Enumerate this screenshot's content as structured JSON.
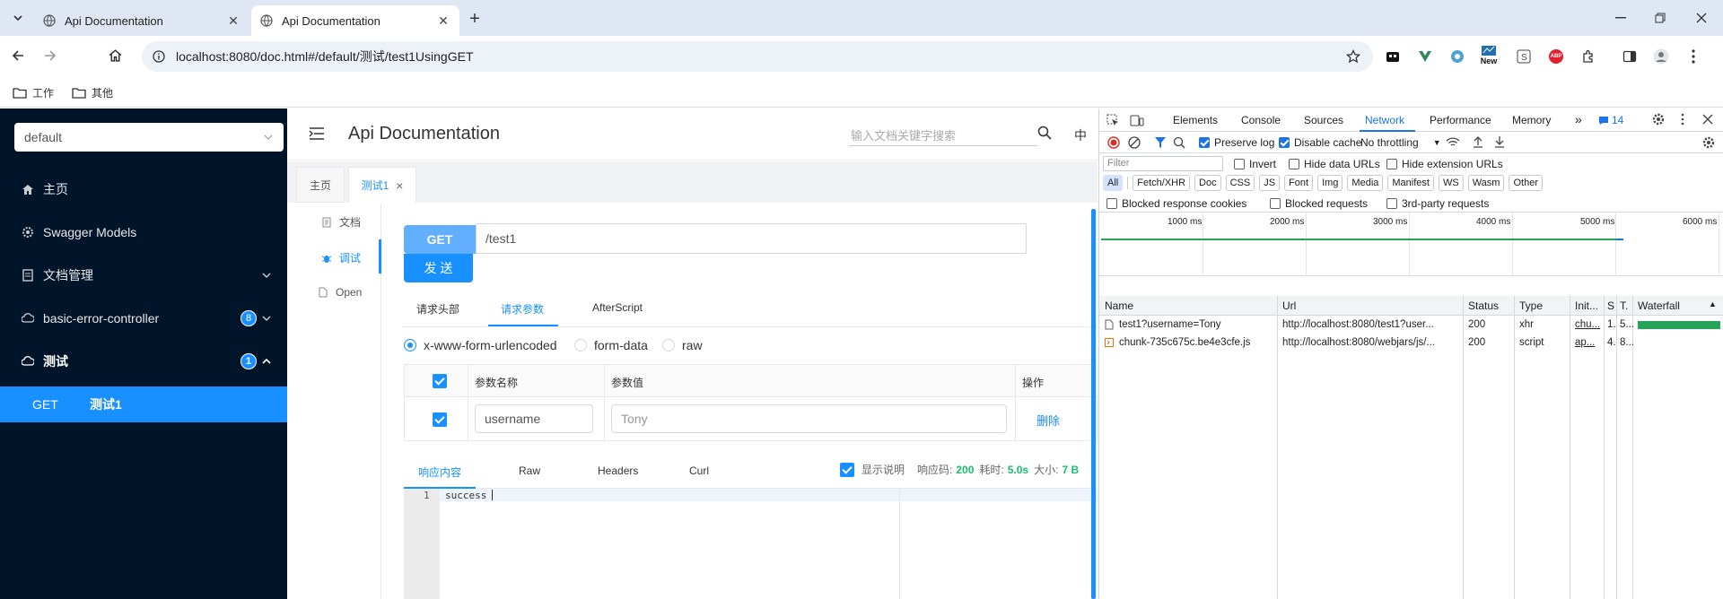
{
  "browser": {
    "tabs": [
      {
        "title": "Api Documentation",
        "active": false
      },
      {
        "title": "Api Documentation",
        "active": true
      }
    ],
    "url": "localhost:8080/doc.html#/default/测试/test1UsingGET",
    "bookmarks": [
      "工作",
      "其他"
    ],
    "extension_new_label": "New",
    "extension_abp_label": "ABP"
  },
  "sidebar": {
    "group_select": "default",
    "items": [
      {
        "label": "主页",
        "icon": "home-icon"
      },
      {
        "label": "Swagger Models",
        "icon": "gear-icon"
      },
      {
        "label": "文档管理",
        "icon": "folder-icon"
      },
      {
        "label": "basic-error-controller",
        "icon": "cloud-icon",
        "badge": "8"
      },
      {
        "label": "测试",
        "icon": "cloud-icon",
        "badge": "1"
      }
    ],
    "sub_item": {
      "method": "GET",
      "label": "测试1"
    }
  },
  "header": {
    "title": "Api Documentation",
    "search_placeholder": "输入文档关键字搜索",
    "lang": "中"
  },
  "page_tabs": [
    {
      "label": "主页"
    },
    {
      "label": "测试1",
      "close": "×"
    }
  ],
  "side_nav": [
    {
      "label": "文档",
      "icon": "document-icon"
    },
    {
      "label": "调试",
      "icon": "debug-icon"
    },
    {
      "label": "Open",
      "icon": "file-icon"
    }
  ],
  "request": {
    "method": "GET",
    "path": "/test1",
    "send_label": "发 送",
    "tabs": [
      "请求头部",
      "请求参数",
      "AfterScript"
    ],
    "active_tab": "请求参数",
    "content_types": [
      "x-www-form-urlencoded",
      "form-data",
      "raw"
    ],
    "table_headers": [
      "参数名称",
      "参数值",
      "操作"
    ],
    "params": [
      {
        "name": "username",
        "value": "Tony",
        "action": "删除"
      }
    ]
  },
  "response": {
    "tabs": [
      "响应内容",
      "Raw",
      "Headers",
      "Curl"
    ],
    "show_desc_label": "显示说明",
    "code_label": "响应码:",
    "code": "200",
    "time_label": "耗时:",
    "time": "5.0s",
    "size_label": "大小:",
    "size": "7 B",
    "line_number": "1",
    "body": "success"
  },
  "devtools": {
    "tabs": [
      "Elements",
      "Console",
      "Sources",
      "Network",
      "Performance",
      "Memory"
    ],
    "active_tab": "Network",
    "issues_count": "14",
    "preserve_log": "Preserve log",
    "disable_cache": "Disable cache",
    "throttling": "No throttling",
    "filter_placeholder": "Filter",
    "invert": "Invert",
    "hide_data_urls": "Hide data URLs",
    "hide_extension_urls": "Hide extension URLs",
    "type_filters": [
      "All",
      "Fetch/XHR",
      "Doc",
      "CSS",
      "JS",
      "Font",
      "Img",
      "Media",
      "Manifest",
      "WS",
      "Wasm",
      "Other"
    ],
    "blocked_cookies": "Blocked response cookies",
    "blocked_requests": "Blocked requests",
    "third_party": "3rd-party requests",
    "timeline_ticks": [
      "1000 ms",
      "2000 ms",
      "3000 ms",
      "4000 ms",
      "5000 ms",
      "6000 ms"
    ],
    "columns": [
      "Name",
      "Url",
      "Status",
      "Type",
      "Init...",
      "S",
      "T.",
      "Waterfall"
    ],
    "rows": [
      {
        "name": "test1?username=Tony",
        "url": "http://localhost:8080/test1?user...",
        "status": "200",
        "type": "xhr",
        "init": "chu...",
        "s": "1.",
        "t": "5...",
        "waterfall": 1.0
      },
      {
        "name": "chunk-735c675c.be4e3cfe.js",
        "url": "http://localhost:8080/webjars/js/...",
        "status": "200",
        "type": "script",
        "init": "ap...",
        "s": "4.",
        "t": "8...",
        "waterfall": 0.0
      }
    ],
    "colors": {
      "active_tab": "#1a73e8",
      "waterfall": "#26a55a"
    }
  },
  "colors": {
    "sidebar_bg": "#001529",
    "accent": "#1890ff",
    "get_method": "#61affe",
    "success": "#19be6b"
  }
}
